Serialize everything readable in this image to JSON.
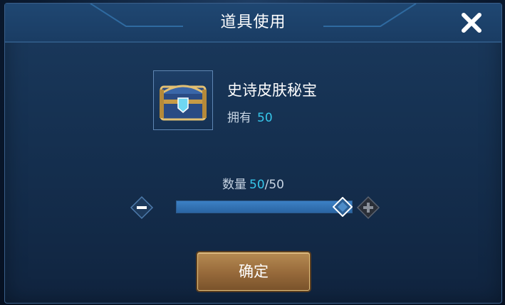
{
  "dialog": {
    "title": "道具使用",
    "close_icon": "close-icon"
  },
  "item": {
    "name": "史诗皮肤秘宝",
    "own_label": "拥有",
    "own_value": "50",
    "icon": "treasure-chest-icon"
  },
  "quantity": {
    "label": "数量",
    "current": "50",
    "max": "/50",
    "fill_fraction": 1.0
  },
  "buttons": {
    "minus_icon": "minus-icon",
    "plus_icon": "plus-icon",
    "confirm_label": "确定"
  },
  "colors": {
    "accent_cyan": "#36c6ea",
    "panel": "#163253",
    "gold": "#b58a52"
  }
}
